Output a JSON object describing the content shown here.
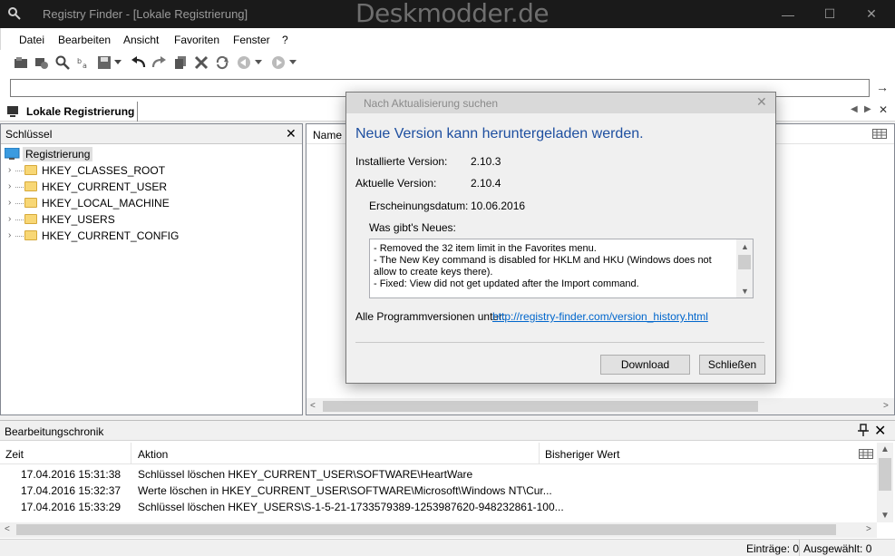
{
  "window": {
    "title": "Registry Finder - [Lokale Registrierung]",
    "watermark": "Deskmodder.de",
    "minimize": "—",
    "maximize": "☐",
    "close": "✕"
  },
  "menu": [
    "Datei",
    "Bearbeiten",
    "Ansicht",
    "Favoriten",
    "Fenster",
    "?"
  ],
  "tab": {
    "label": "Lokale Registrierung"
  },
  "left_panel": {
    "header": "Schlüssel",
    "root": "Registrierung",
    "items": [
      "HKEY_CLASSES_ROOT",
      "HKEY_CURRENT_USER",
      "HKEY_LOCAL_MACHINE",
      "HKEY_USERS",
      "HKEY_CURRENT_CONFIG"
    ]
  },
  "right_panel": {
    "column_name": "Name"
  },
  "history": {
    "title": "Bearbeitungschronik",
    "columns": [
      "Zeit",
      "Aktion",
      "Bisheriger Wert"
    ],
    "rows": [
      {
        "time": "17.04.2016 15:31:38",
        "action": "Schlüssel löschen HKEY_CURRENT_USER\\SOFTWARE\\HeartWare"
      },
      {
        "time": "17.04.2016 15:32:37",
        "action": "Werte löschen in HKEY_CURRENT_USER\\SOFTWARE\\Microsoft\\Windows NT\\Cur..."
      },
      {
        "time": "17.04.2016 15:33:29",
        "action": "Schlüssel löschen HKEY_USERS\\S-1-5-21-1733579389-1253987620-948232861-100..."
      }
    ]
  },
  "statusbar": {
    "entries": "Einträge: 0",
    "selected": "Ausgewählt: 0"
  },
  "dialog": {
    "title": "Nach Aktualisierung suchen",
    "heading": "Neue Version kann heruntergeladen werden.",
    "installed_label": "Installierte Version:",
    "installed_value": "2.10.3",
    "current_label": "Aktuelle Version:",
    "current_value": "2.10.4",
    "release_label": "Erscheinungsdatum:",
    "release_value": "10.06.2016",
    "whats_new_label": "Was gibt's Neues:",
    "changes": [
      "- Removed the 32 item limit in the Favorites menu.",
      "- The New Key command is disabled for HKLM and HKU (Windows does not allow to create keys there).",
      "- Fixed: View did not get updated after the Import command."
    ],
    "all_versions_label": "Alle Programmversionen unter:",
    "all_versions_link": "http://registry-finder.com/version_history.html",
    "download_button": "Download",
    "close_button": "Schließen"
  },
  "colors": {
    "accent_heading": "#1e4fa0",
    "link": "#0066cc",
    "title_bar": "#1a1a1a",
    "folder": "#f8d775"
  }
}
